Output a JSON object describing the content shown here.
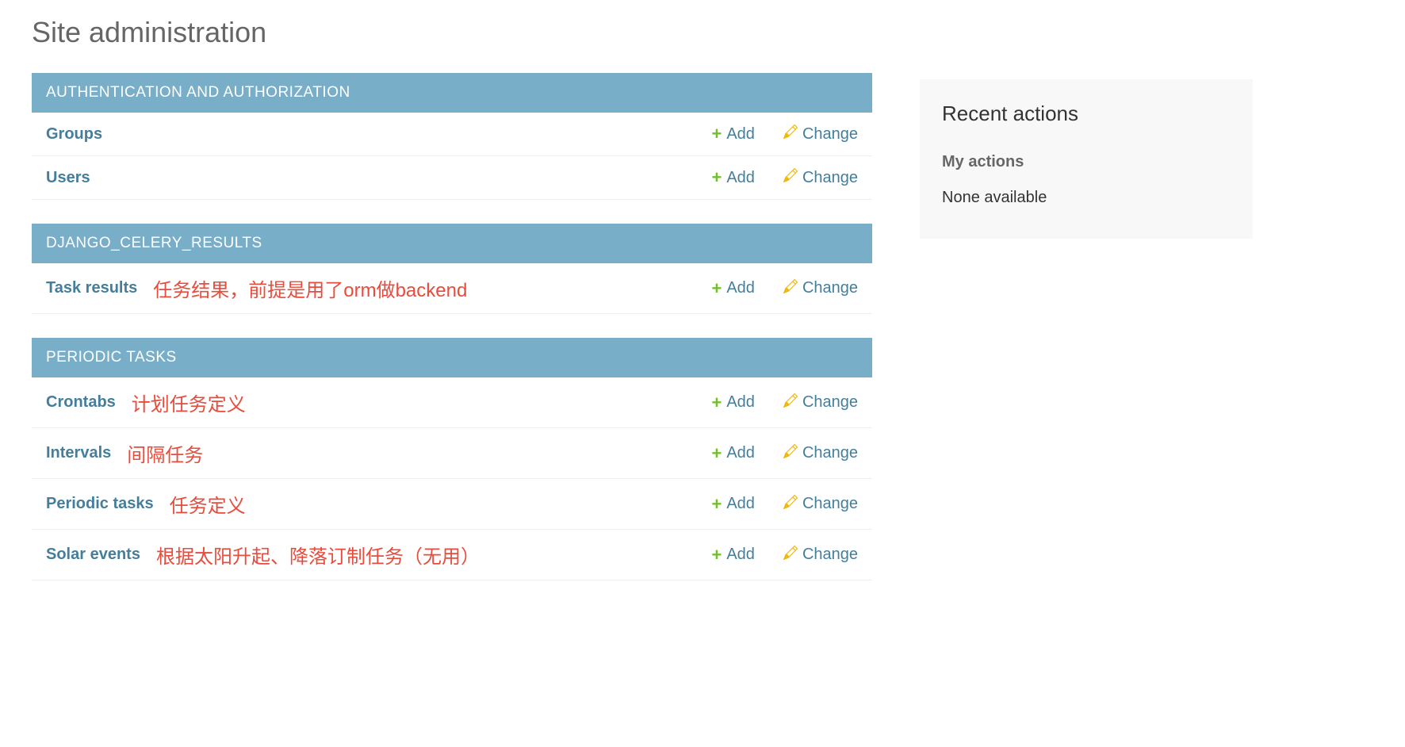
{
  "page_title": "Site administration",
  "add_label": "Add",
  "change_label": "Change",
  "modules": [
    {
      "header": "AUTHENTICATION AND AUTHORIZATION",
      "models": [
        {
          "name": "Groups",
          "annotation": ""
        },
        {
          "name": "Users",
          "annotation": ""
        }
      ]
    },
    {
      "header": "DJANGO_CELERY_RESULTS",
      "models": [
        {
          "name": "Task results",
          "annotation": "任务结果，前提是用了orm做backend"
        }
      ]
    },
    {
      "header": "PERIODIC TASKS",
      "models": [
        {
          "name": "Crontabs",
          "annotation": "计划任务定义"
        },
        {
          "name": "Intervals",
          "annotation": "间隔任务"
        },
        {
          "name": "Periodic tasks",
          "annotation": "任务定义"
        },
        {
          "name": "Solar events",
          "annotation": "根据太阳升起、降落订制任务（无用）"
        }
      ]
    }
  ],
  "sidebar": {
    "title": "Recent actions",
    "subtitle": "My actions",
    "empty_text": "None available"
  }
}
